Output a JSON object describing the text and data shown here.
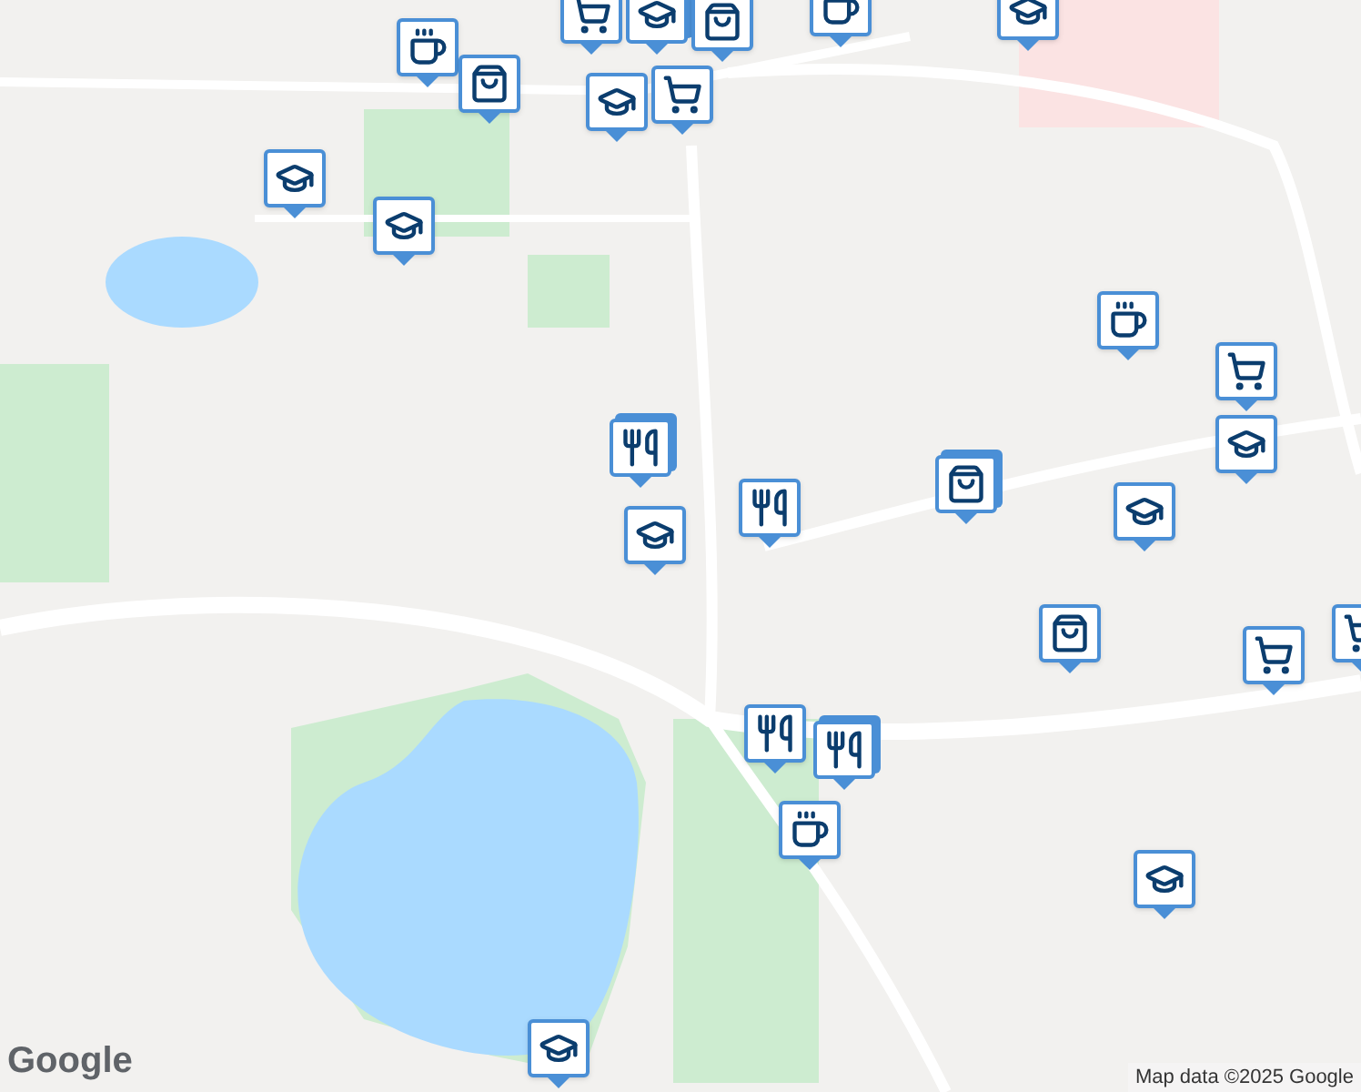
{
  "map": {
    "logo": "Google",
    "attribution": "Map data ©2025 Google"
  }
}
